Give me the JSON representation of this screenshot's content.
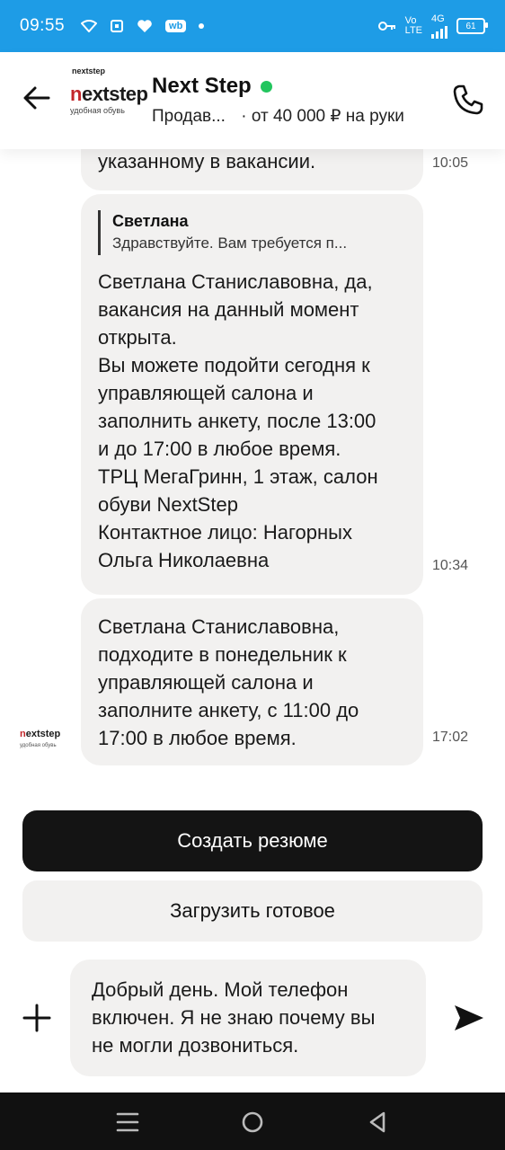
{
  "status_bar": {
    "time": "09:55",
    "badge": "wb",
    "network_top": "Vo",
    "network_bottom": "LTE",
    "network_type": "4G",
    "battery": "61"
  },
  "header": {
    "logo_brand": "nextstep",
    "logo_sub": "удобная обувь",
    "title": "Next Step",
    "online": true,
    "position": "Продав...",
    "salary": "· от 40 000 ₽ на руки"
  },
  "messages": [
    {
      "text": "указанному в вакансии.",
      "time": "10:05"
    },
    {
      "quote_author": "Светлана",
      "quote_text": "Здравствуйте. Вам требуется п...",
      "text": "Светлана Станиславовна, да,\nвакансия на данный момент\nоткрыта.\nВы можете подойти сегодня к\nуправляющей салона и\nзаполнить анкету, после 13:00\nи до 17:00 в любое время.\nТРЦ МегаГринн, 1 этаж, салон\nобуви NextStep\nКонтактное лицо: Нагорных\nОльга Николаевна",
      "time": "10:34"
    },
    {
      "text": "Светлана Станиславовна,\nподходите в понедельник к\nуправляющей салона и\nзаполните анкету, с 11:00 до\n17:00 в любое время.",
      "time": "17:02"
    }
  ],
  "actions": {
    "create_resume": "Создать резюме",
    "upload_ready": "Загрузить готовое"
  },
  "composer": {
    "text": "Добрый день. Мой телефон\nвключен. Я не знаю почему вы\nне могли дозвониться."
  },
  "colors": {
    "status_bar": "#1e9ce6",
    "online": "#22c55e",
    "primary_button": "#141414",
    "bubble": "#f2f1f0"
  },
  "icons": [
    "back-arrow-icon",
    "phone-icon",
    "plus-icon",
    "send-icon",
    "menu-icon",
    "home-icon",
    "back-triangle-icon"
  ]
}
